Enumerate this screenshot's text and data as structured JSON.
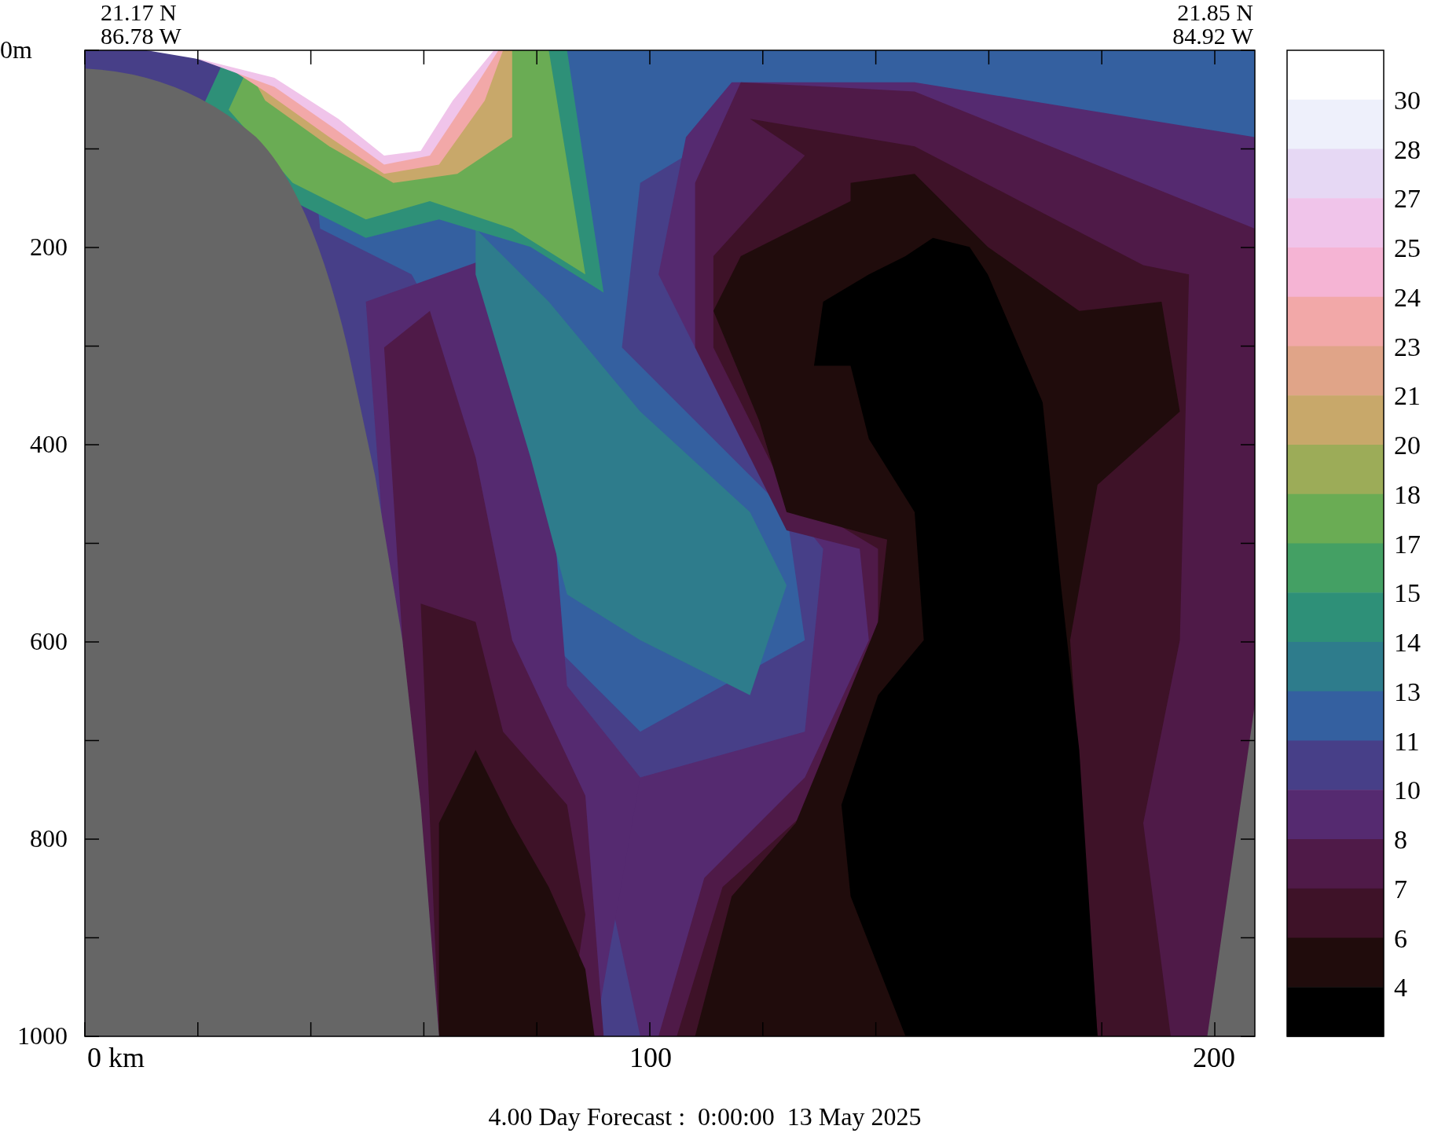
{
  "header": {
    "left": [
      "21.17 N",
      "86.78 W"
    ],
    "right": [
      "21.85 N",
      "84.92 W"
    ]
  },
  "y_axis": {
    "labels": [
      "0m",
      "200",
      "400",
      "600",
      "800",
      "1000"
    ]
  },
  "x_axis": {
    "labels": [
      "0 km",
      "100",
      "200"
    ]
  },
  "colorbar": {
    "labels": [
      "30",
      "28",
      "27",
      "25",
      "24",
      "23",
      "21",
      "20",
      "18",
      "17",
      "15",
      "14",
      "13",
      "11",
      "10",
      "8",
      "7",
      "6",
      "4"
    ]
  },
  "caption": "4.00 Day Forecast :  0:00:00  13 May 2025"
}
